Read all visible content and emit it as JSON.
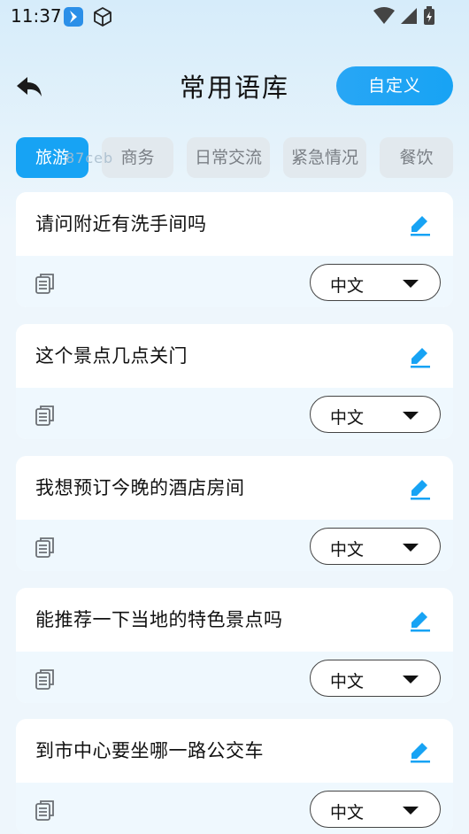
{
  "status_bar": {
    "time": "11:37",
    "icons": [
      "app-notification-icon",
      "cube-icon",
      "wifi-icon",
      "cellular-signal-icon",
      "battery-charging-icon"
    ]
  },
  "header": {
    "title": "常用语库",
    "back_icon": "back-arrow-icon",
    "custom_button_label": "自定义"
  },
  "tabs": [
    {
      "label": "旅游",
      "active": true
    },
    {
      "label": "商务",
      "active": false
    },
    {
      "label": "日常交流",
      "active": false
    },
    {
      "label": "紧急情况",
      "active": false
    },
    {
      "label": "餐饮",
      "active": false
    }
  ],
  "watermark": "87ceb",
  "phrases": [
    {
      "text": "请问附近有洗手间吗",
      "language": "中文"
    },
    {
      "text": "这个景点几点关门",
      "language": "中文"
    },
    {
      "text": "我想预订今晚的酒店房间",
      "language": "中文"
    },
    {
      "text": "能推荐一下当地的特色景点吗",
      "language": "中文"
    },
    {
      "text": "到市中心要坐哪一路公交车",
      "language": "中文"
    }
  ],
  "colors": {
    "accent": "#17a3f4",
    "tab_inactive_bg": "#e2e9ee",
    "card_bottom_bg": "#eff8fe"
  }
}
